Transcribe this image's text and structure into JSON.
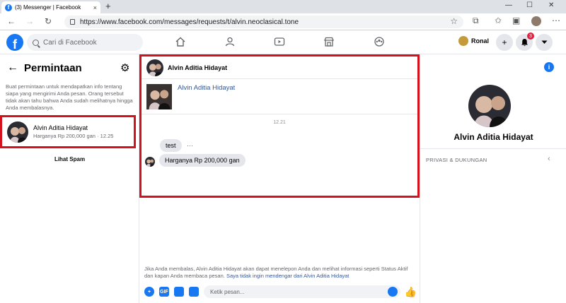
{
  "browser": {
    "tab_title": "(3) Messenger | Facebook",
    "tab_close": "×",
    "new_tab": "+",
    "url": "https://www.facebook.com/messages/requests/t/alvin.neoclasical.tone",
    "minimize": "—",
    "maximize": "☐",
    "close": "✕"
  },
  "fbnav": {
    "search_placeholder": "Cari di Facebook",
    "user_name": "Ronal",
    "notification_count": "3"
  },
  "left": {
    "title": "Permintaan",
    "info": "Buat permintaan untuk mendapatkan info tentang siapa yang mengirimi Anda pesan. Orang tersebut tidak akan tahu bahwa Anda sudah melihatnya hingga Anda membalasnya.",
    "request": {
      "name": "Alvin Aditia Hidayat",
      "preview": "Harganya Rp 200,000 gan · 12.25"
    },
    "spam_link": "Lihat Spam"
  },
  "conversation": {
    "name": "Alvin Aditia Hidayat",
    "card_name": "Alvin Aditia Hidayat",
    "time": "12.21",
    "messages": [
      "test",
      "Harganya Rp 200,000 gan"
    ],
    "more": "···",
    "footer_text": "Jika Anda membalas, Alvin Aditia Hidayat akan dapat menelepon Anda dan melihat informasi seperti Status Aktif dan kapan Anda membaca pesan.",
    "footer_link": "Saya tidak ingin mendengar dari Alvin Aditia Hidayat",
    "composer_placeholder": "Ketik pesan...",
    "gif_label": "GIF"
  },
  "right": {
    "name": "Alvin Aditia Hidayat",
    "section": "PRIVASI & DUKUNGAN",
    "info_icon": "i"
  },
  "colors": {
    "highlight": "#d4121e",
    "fb_blue": "#1877f2"
  }
}
